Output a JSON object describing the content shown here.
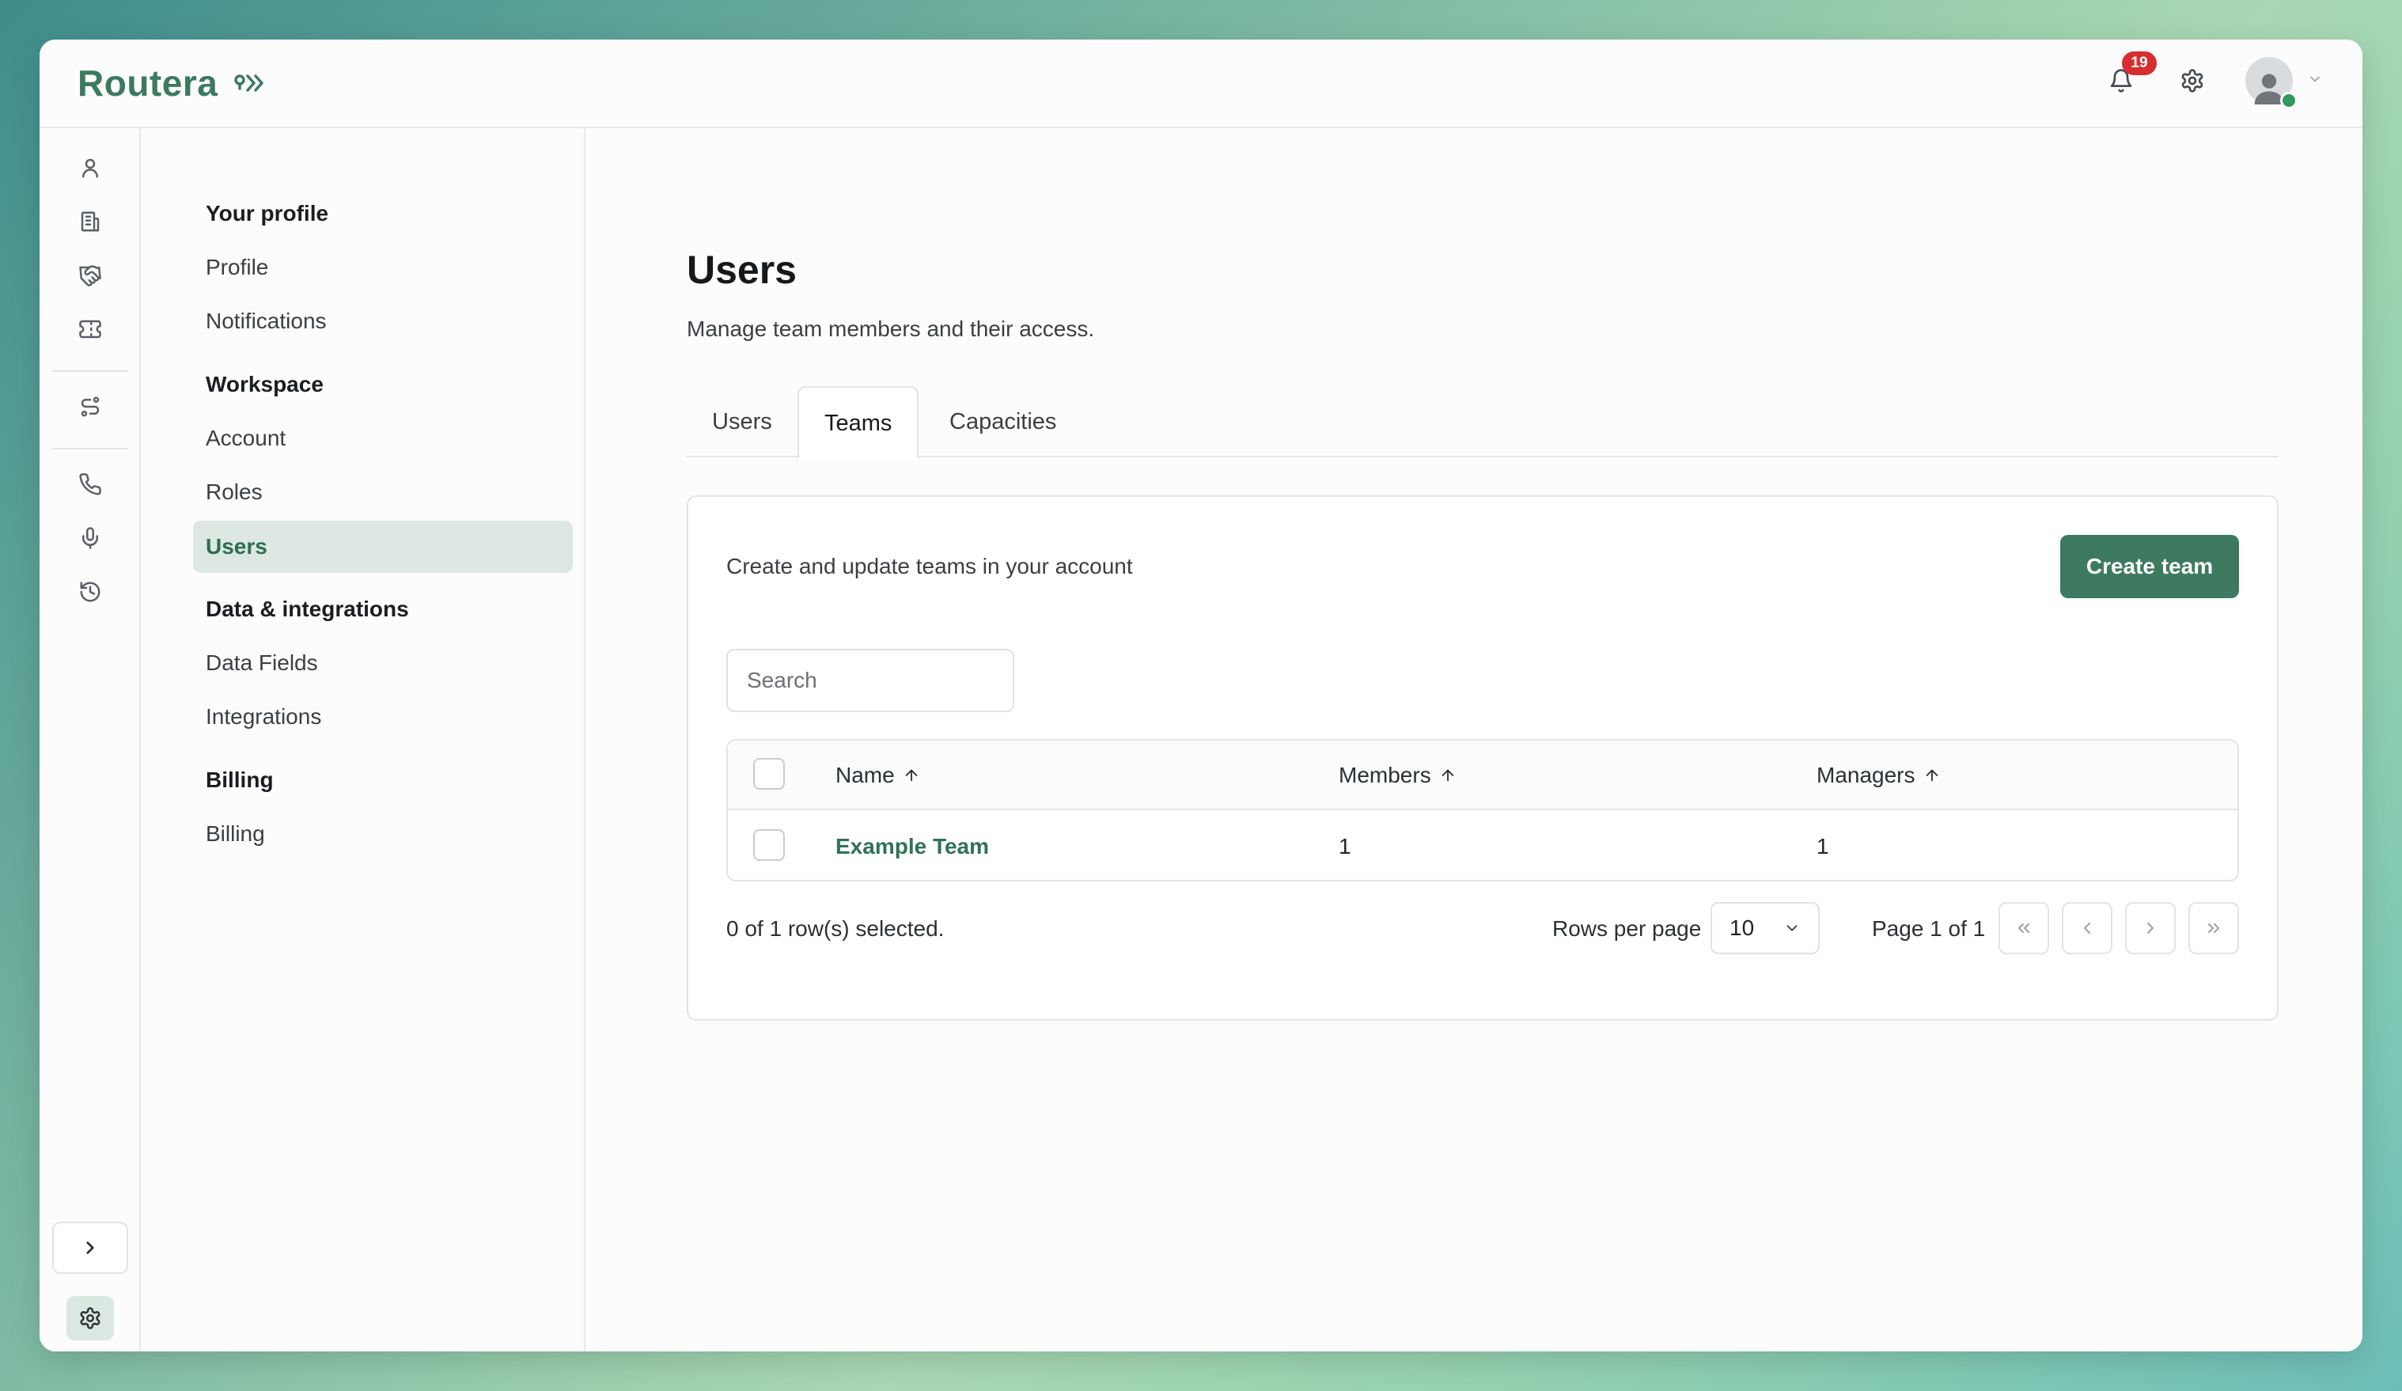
{
  "app": {
    "brand": "Routera",
    "notifications_count": "19"
  },
  "subnav": {
    "sections": [
      {
        "heading": "Your profile",
        "items": [
          "Profile",
          "Notifications"
        ]
      },
      {
        "heading": "Workspace",
        "items": [
          "Account",
          "Roles",
          "Users"
        ]
      },
      {
        "heading": "Data & integrations",
        "items": [
          "Data Fields",
          "Integrations"
        ]
      },
      {
        "heading": "Billing",
        "items": [
          "Billing"
        ]
      }
    ],
    "active_item": "Users"
  },
  "rail": {
    "icons": [
      "user-icon",
      "building-icon",
      "handshake-icon",
      "ticket-icon",
      "routing-icon",
      "phone-icon",
      "microphone-icon",
      "history-icon"
    ],
    "bottom_icons": [
      "expand-icon",
      "gear-icon",
      "sidebar-panel-icon"
    ]
  },
  "page": {
    "title": "Users",
    "subtitle": "Manage team members and their access.",
    "tabs": [
      "Users",
      "Teams",
      "Capacities"
    ],
    "active_tab": "Teams"
  },
  "card": {
    "description": "Create and update teams in your account",
    "create_button": "Create team",
    "search_placeholder": "Search",
    "columns": [
      "Name",
      "Members",
      "Managers"
    ],
    "rows": [
      {
        "name": "Example Team",
        "members": "1",
        "managers": "1"
      }
    ],
    "selection_status": "0 of 1 row(s) selected.",
    "rows_per_page_label": "Rows per page",
    "rows_per_page_value": "10",
    "page_label": "Page 1 of 1"
  },
  "colors": {
    "brand": "#3c7a5f",
    "primary_button": "#3d7a5f",
    "active_nav_bg": "#dce8e1",
    "badge": "#d62e2e",
    "online": "#2f9a5a"
  }
}
